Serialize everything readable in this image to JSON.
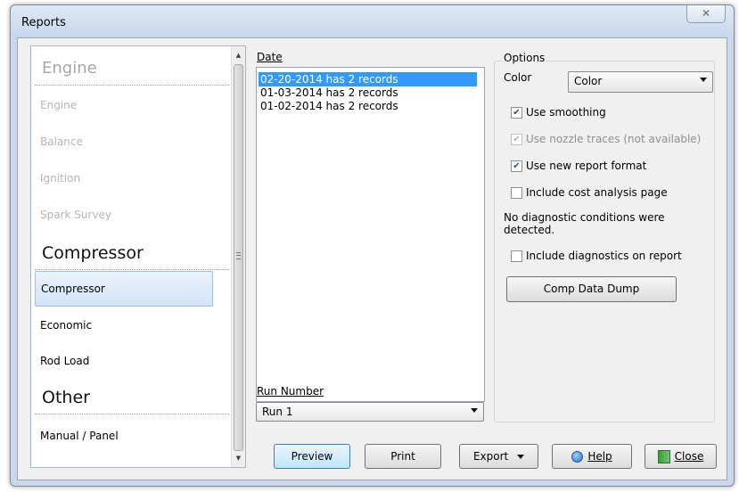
{
  "window": {
    "title": "Reports",
    "close_glyph": "✕"
  },
  "nav": {
    "sections": [
      {
        "heading": "Engine",
        "items": [
          "Engine",
          "Balance",
          "Ignition",
          "Spark Survey"
        ]
      },
      {
        "heading": "Compressor",
        "items": [
          "Compressor",
          "Economic",
          "Rod Load"
        ]
      },
      {
        "heading": "Other",
        "items": [
          "Manual / Panel"
        ]
      }
    ],
    "selected": "Compressor"
  },
  "date": {
    "label": "Date",
    "items": [
      "02-20-2014 has 2 records",
      "01-03-2014 has 2 records",
      "01-02-2014 has 2 records"
    ],
    "selected_index": 0
  },
  "run": {
    "label": "Run Number",
    "value": "Run 1"
  },
  "options": {
    "legend": "Options",
    "color_label": "Color",
    "color_value": "Color",
    "use_smoothing": "Use smoothing",
    "use_nozzle": "Use nozzle traces (not available)",
    "use_new_format": "Use new report format",
    "include_cost": "Include cost analysis page",
    "diag_message": "No diagnostic conditions were detected.",
    "include_diag": "Include diagnostics on report",
    "comp_dump": "Comp Data Dump",
    "checked": {
      "smoothing": true,
      "nozzle": true,
      "new_format": true,
      "cost": false,
      "diag": false
    }
  },
  "buttons": {
    "preview": "Preview",
    "print": "Print",
    "export": "Export",
    "help": "Help",
    "close": "Close"
  },
  "colors": {
    "selection": "#3399ff",
    "nav_selected": "#d3e4f7"
  },
  "icons": {
    "help": "help-icon",
    "close": "exit-door-icon",
    "dropdown": "caret-down-icon"
  }
}
